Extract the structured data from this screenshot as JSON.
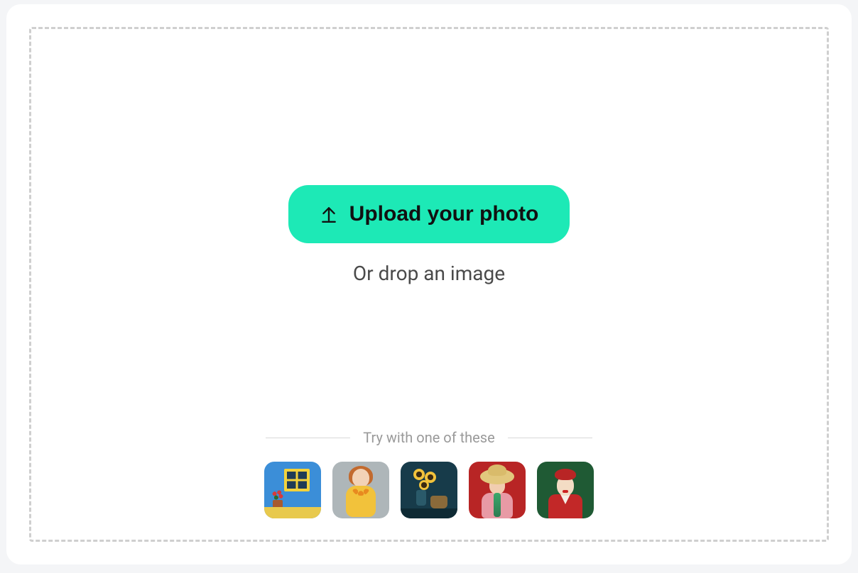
{
  "upload": {
    "button_label": "Upload your photo",
    "drop_hint": "Or drop an image"
  },
  "samples": {
    "title": "Try with one of these",
    "items": [
      {
        "name": "sample-blue-wall-yellow-window"
      },
      {
        "name": "sample-girl-yellow-dress"
      },
      {
        "name": "sample-sunflowers-still-life"
      },
      {
        "name": "sample-woman-straw-hat-red"
      },
      {
        "name": "sample-woman-red-beret-green"
      }
    ]
  },
  "colors": {
    "accent": "#1de9b6",
    "border_dash": "#cfcfcf"
  }
}
